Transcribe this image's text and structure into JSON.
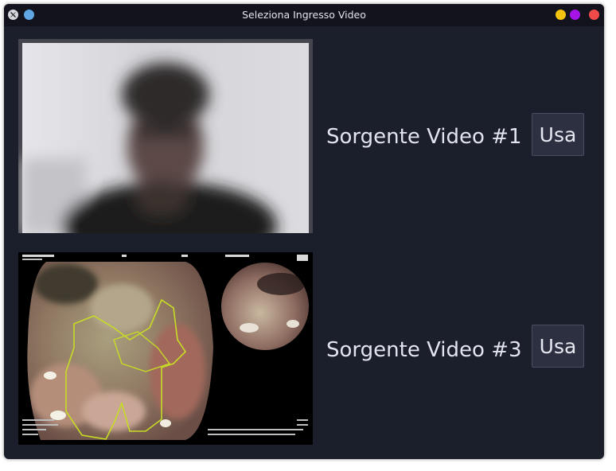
{
  "window": {
    "title": "Seleziona Ingresso Video"
  },
  "sources": [
    {
      "label": "Sorgente Video #1",
      "button_label": "Usa",
      "preview": "webcam-person-blurred"
    },
    {
      "label": "Sorgente Video #3",
      "button_label": "Usa",
      "preview": "endoscopy-image"
    }
  ],
  "colors": {
    "window_bg": "#1b1e2b",
    "titlebar_bg": "#12131c",
    "button_bg": "#2d3040",
    "text": "#e2e4ee",
    "minimize": "#f2c40f",
    "maximize": "#a513e6",
    "close": "#ef4a4a"
  }
}
